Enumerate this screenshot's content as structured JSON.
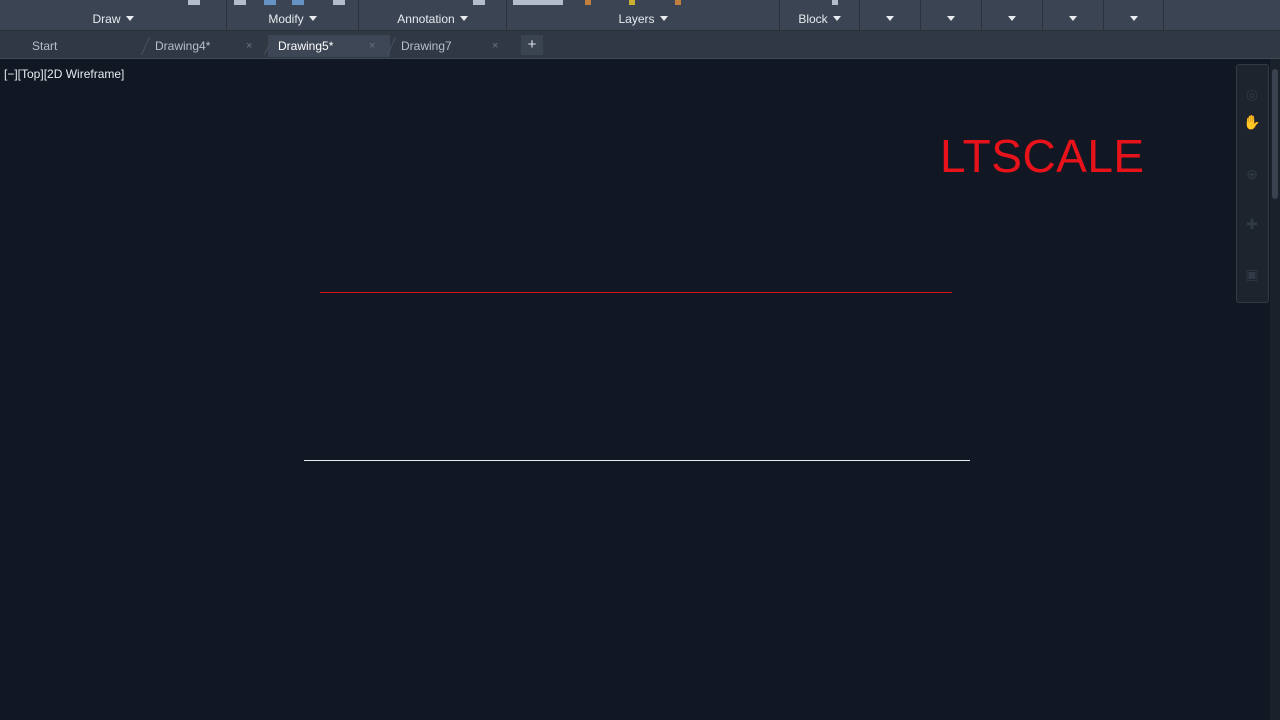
{
  "ribbon": {
    "panels": {
      "draw": "Draw",
      "modify": "Modify",
      "annotation": "Annotation",
      "layers": "Layers",
      "block": "Block"
    }
  },
  "tabs": {
    "start": "Start",
    "drawing4": "Drawing4*",
    "drawing5": "Drawing5*",
    "drawing7": "Drawing7",
    "close_glyph": "×",
    "add_glyph": "+"
  },
  "viewport": {
    "view_label": "[−][Top][2D Wireframe]",
    "annotation_text": "LTSCALE",
    "annotation_color": "#e8121b",
    "background_color": "#121823"
  },
  "navbar": {
    "icons": [
      "steering-wheel-icon",
      "orbit-icon",
      "pan-icon",
      "zoom-extents-icon",
      "showmotion-icon"
    ]
  }
}
